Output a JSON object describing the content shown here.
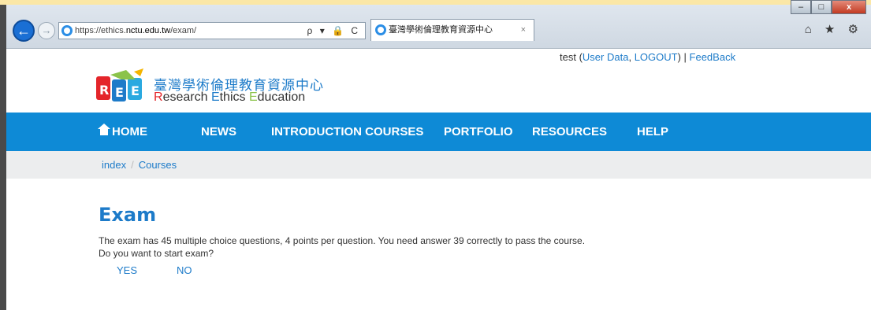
{
  "browser": {
    "url_prefix": "https://ethics.",
    "url_host": "nctu.edu.tw",
    "url_path": "/exam/",
    "address_tools": "ρ ▾ 🔒 C",
    "tab_title": "臺灣學術倫理教育資源中心",
    "tab_close": "×",
    "minimize": "–",
    "maximize": "□",
    "close": "x",
    "right_icons": "⌂ ★ ⚙"
  },
  "userbar": {
    "user": "test",
    "open_paren": " (",
    "user_data": "User Data",
    "comma": ", ",
    "logout": "LOGOUT",
    "close_sep": ") | ",
    "feedback": "FeedBack"
  },
  "logo": {
    "cn": "臺灣學術倫理教育資源中心",
    "en_r": "R",
    "en_esearch": "esearch ",
    "en_e1": "E",
    "en_thics": "thics ",
    "en_e2": "E",
    "en_ducation": "ducation"
  },
  "nav": {
    "home": "HOME",
    "news": "NEWS",
    "intro": "INTRODUCTION COURSES",
    "portfolio": "PORTFOLIO",
    "resources": "RESOURCES",
    "help": "HELP"
  },
  "breadcrumb": {
    "index": "index",
    "sep": "/",
    "courses": "Courses"
  },
  "main": {
    "title": "Exam",
    "line1": "The exam has 45 multiple choice questions, 4 points per question. You need answer 39 correctly to pass the course.",
    "line2": "Do you want to start exam?",
    "yes": "YES",
    "no": "NO"
  },
  "colors": {
    "accent": "#1d7bc9",
    "navbar": "#0e8ad6",
    "breadcrumb_bg": "#ecedee"
  }
}
